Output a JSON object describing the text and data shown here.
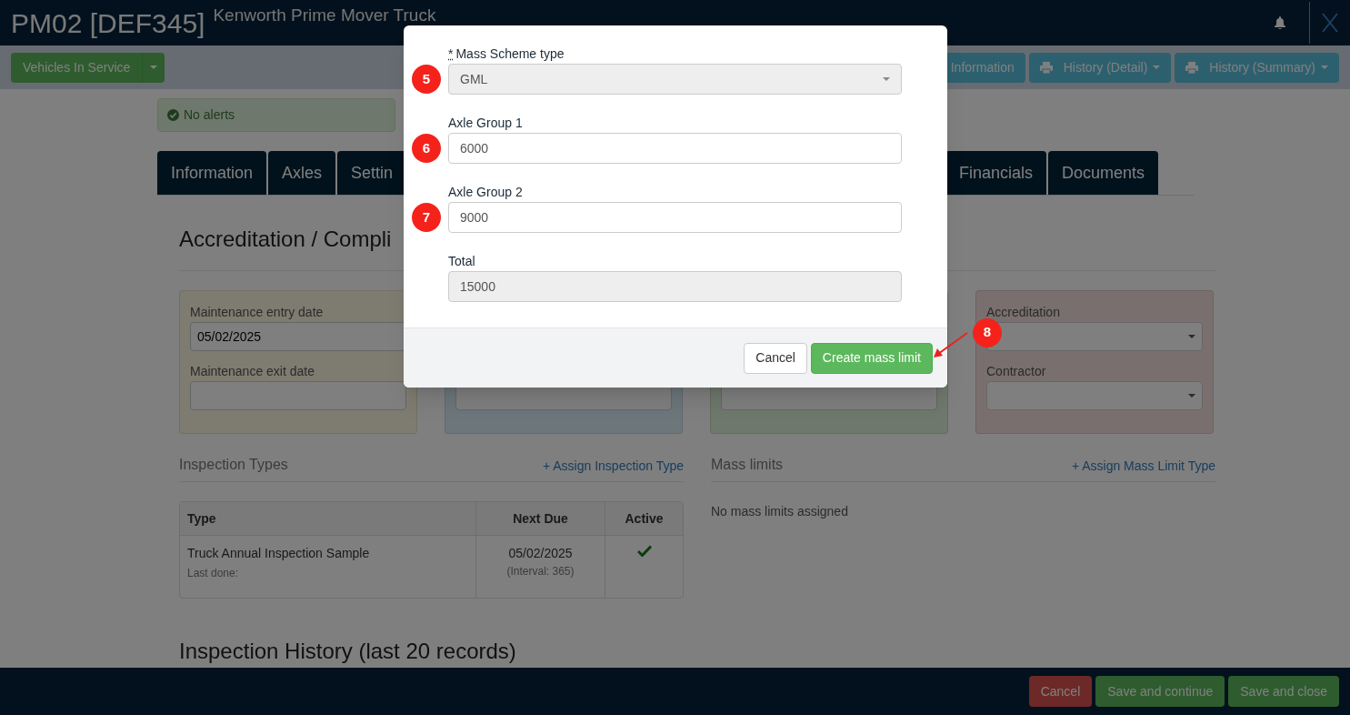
{
  "header": {
    "title": "PM02 [DEF345]",
    "subtitle": "Kenworth Prime Mover Truck"
  },
  "toolbar": {
    "status_button": "Vehicles In Service",
    "buttons": [
      {
        "label": "Information",
        "kind": "plain"
      },
      {
        "label": "History (Detail)",
        "kind": "print"
      },
      {
        "label": "History (Summary)",
        "kind": "print"
      }
    ]
  },
  "alert": "No alerts",
  "tabs": {
    "left": [
      "Information",
      "Axles",
      "Settin"
    ],
    "right": [
      "Financials",
      "Documents"
    ]
  },
  "section_title": "Accreditation / Compli",
  "cards": [
    {
      "color": "#7e7c71",
      "fields": [
        {
          "label": "Maintenance entry date",
          "value": "05/02/2025",
          "kind": "text"
        },
        {
          "label": "Maintenance exit date",
          "kind": "text"
        }
      ]
    },
    {
      "color": "#6c767b",
      "fields": [
        {
          "kind": "text"
        }
      ]
    },
    {
      "color": "#6f786c",
      "fields": [
        {
          "kind": "text"
        }
      ]
    },
    {
      "color": "#796f6f",
      "fields": [
        {
          "label": "Accreditation",
          "kind": "select"
        },
        {
          "label": "Contractor",
          "kind": "select"
        }
      ]
    }
  ],
  "inspection_types": {
    "title": "Inspection Types",
    "link": "+ Assign Inspection Type",
    "columns": [
      "Type",
      "Next Due",
      "Active"
    ],
    "rows": [
      {
        "type": "Truck Annual Inspection Sample",
        "sub": "Last done:",
        "due": "05/02/2025",
        "interval": "(Interval: 365)",
        "active": true
      }
    ]
  },
  "mass_limits": {
    "title": "Mass limits",
    "link": "+ Assign Mass Limit Type",
    "empty": "No mass limits assigned"
  },
  "history_title": "Inspection History (last 20 records)",
  "footer_buttons": [
    {
      "label": "Cancel",
      "kind": "danger"
    },
    {
      "label": "Save and continue",
      "kind": "success"
    },
    {
      "label": "Save and close",
      "kind": "success"
    }
  ],
  "modal": {
    "fields": [
      {
        "mark": "*",
        "label": "Mass Scheme type",
        "value": "GML",
        "kind": "select",
        "disabled": true,
        "marker": "5"
      },
      {
        "label": "Axle Group 1",
        "value": "6000",
        "kind": "text",
        "disabled": false,
        "marker": "6"
      },
      {
        "label": "Axle Group 2",
        "value": "9000",
        "kind": "text",
        "disabled": false,
        "marker": "7"
      },
      {
        "label": "Total",
        "value": "15000",
        "kind": "text",
        "disabled": true
      }
    ],
    "cancel": "Cancel",
    "submit": "Create mass limit",
    "submit_marker": "8"
  }
}
